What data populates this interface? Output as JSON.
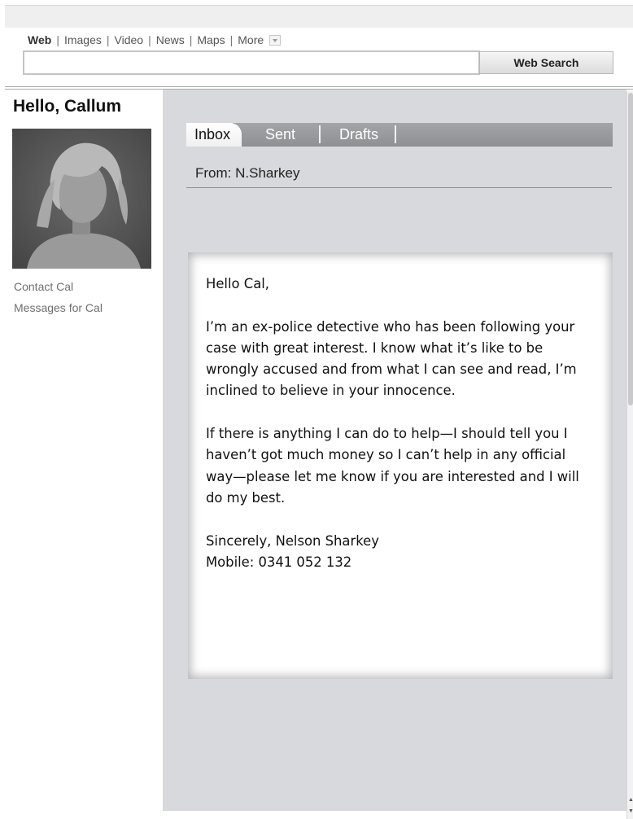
{
  "search": {
    "nav": [
      "Web",
      "Images",
      "Video",
      "News",
      "Maps",
      "More"
    ],
    "input_value": "",
    "button_label": "Web Search"
  },
  "sidebar": {
    "greeting": "Hello, Callum",
    "links": [
      "Contact Cal",
      "Messages for Cal"
    ]
  },
  "mail": {
    "tabs": [
      "Inbox",
      "Sent",
      "Drafts"
    ],
    "active_tab": "Inbox",
    "from": "From: N.Sharkey",
    "body": {
      "salutation": "Hello Cal,",
      "para1": "I’m an ex-police detective who has been following your case with great interest. I know what it’s like to be wrongly accused and from what I can see and read, I’m inclined to believe in your innocence.",
      "para2": "If there is anything I can do to help—I should tell you I haven’t got much money so I can’t help in any official way—please let me know if you are interested and I will do my best.",
      "signoff": "Sincerely, Nelson Sharkey",
      "mobile": "Mobile: 0341 052 132"
    }
  },
  "colors": {
    "main_bg": "#d8d9dc",
    "tab_bar": "#9a9b9f",
    "link_gray": "#6f6f6f"
  },
  "icons": [
    "more-dropdown-icon",
    "scroll-up-icon",
    "scroll-down-icon"
  ]
}
